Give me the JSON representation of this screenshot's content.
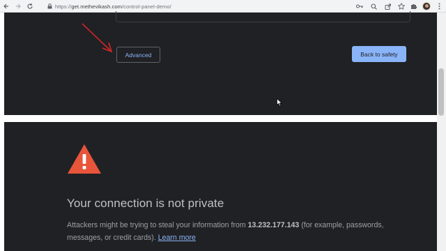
{
  "toolbar": {
    "back_icon": "arrow-left-icon",
    "forward_icon": "arrow-right-icon",
    "reload_icon": "reload-icon",
    "url_prefix": "https://",
    "url_main": "get.methevikash.com",
    "url_path": "/control-panel-demo/",
    "icons": [
      "key-icon",
      "zoom-icon",
      "share-icon",
      "star-icon",
      "extensions-icon",
      "profile-avatar",
      "menu-icon"
    ]
  },
  "interstitial": {
    "advanced_label": "Advanced",
    "back_to_safety_label": "Back to safety",
    "heading": "Your connection is not private",
    "body_before_ip": "Attackers might be trying to steal your information from ",
    "ip_address": "13.232.177.143",
    "body_after_ip": " (for example, passwords, messages, or credit cards). ",
    "learn_more_label": "Learn more"
  },
  "colors": {
    "page_bg": "#202124",
    "link": "#8ab4f8",
    "warning_red": "#e8553a",
    "annotation_arrow": "#d0262a"
  }
}
